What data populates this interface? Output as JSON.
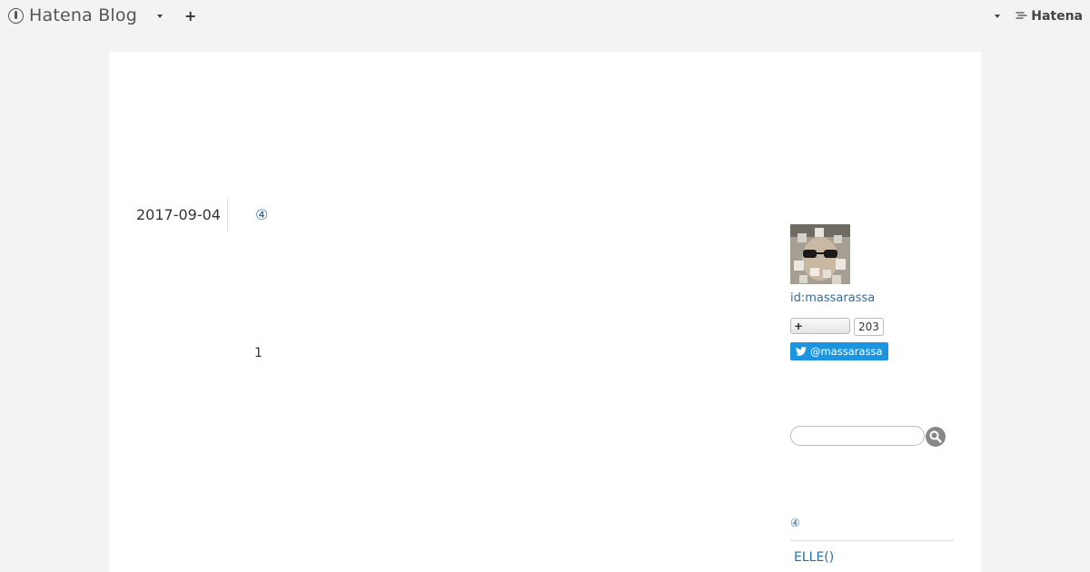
{
  "header": {
    "logo_text": "Hatena Blog",
    "add_label": "+",
    "brand_label": "Hatena"
  },
  "entry": {
    "date": "2017-09-04",
    "title": "④",
    "body_text": "1"
  },
  "sidebar": {
    "user_id": "id:massarassa",
    "subscribe_label": "+",
    "subscriber_count": "203",
    "twitter_label": "@massarassa",
    "search_placeholder": "",
    "module_title": "④",
    "module_link": "ELLE()"
  },
  "colors": {
    "page_bg": "#f3f3f3",
    "content_bg": "#ffffff",
    "link": "#2d6ea4",
    "twitter": "#1b95e0",
    "search_button": "#888888"
  }
}
